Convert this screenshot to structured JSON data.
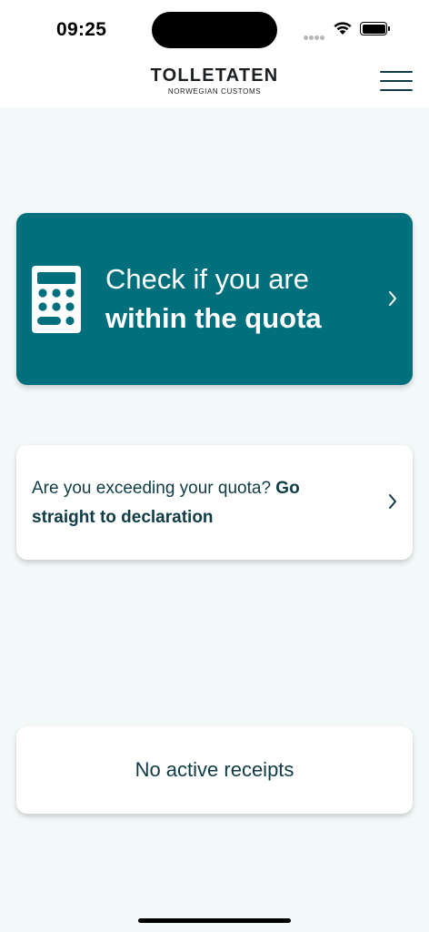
{
  "status_bar": {
    "time": "09:25"
  },
  "header": {
    "brand_name": "TOLLETATEN",
    "brand_subtitle": "NORWEGIAN CUSTOMS",
    "menu_icon": "hamburger-menu-icon"
  },
  "quota_card": {
    "line1": "Check if you are",
    "line2": "within the quota",
    "icon": "calculator-icon",
    "chevron_icon": "chevron-right-icon"
  },
  "declaration_card": {
    "text_regular": "Are you exceeding your quota?",
    "text_bold": "Go straight to declaration",
    "chevron_icon": "chevron-right-icon"
  },
  "receipts_card": {
    "text": "No active receipts"
  },
  "colors": {
    "primary_teal": "#01707c",
    "text_dark": "#0f3b44",
    "background": "#f3f8f8"
  }
}
